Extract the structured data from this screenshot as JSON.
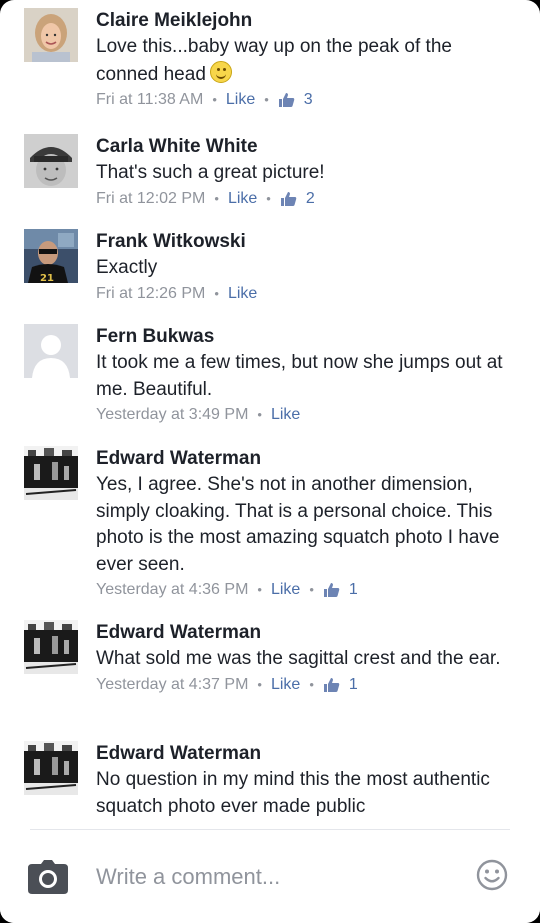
{
  "comments": [
    {
      "author": "Claire Meiklejohn",
      "text": "Love this...baby way up on the peak of the conned head",
      "emoji": "smiley-emoji",
      "time": "Fri at 11:38 AM",
      "like_label": "Like",
      "likes": "3"
    },
    {
      "author": "Carla White White",
      "text": "That's such a great picture!",
      "time": "Fri at 12:02 PM",
      "like_label": "Like",
      "likes": "2"
    },
    {
      "author": "Frank Witkowski",
      "text": "Exactly",
      "time": "Fri at 12:26 PM",
      "like_label": "Like"
    },
    {
      "author": "Fern Bukwas",
      "text": "It took me a few times, but now she jumps out at me. Beautiful.",
      "time": "Yesterday at 3:49 PM",
      "like_label": "Like"
    },
    {
      "author": "Edward Waterman",
      "text": "Yes, I agree. She's not in another dimension, simply cloaking. That is a personal choice. This photo is the most amazing squatch photo I have ever seen.",
      "time": "Yesterday at 4:36 PM",
      "like_label": "Like",
      "likes": "1"
    },
    {
      "author": "Edward Waterman",
      "text": "What sold me was the sagittal crest and the ear.",
      "time": "Yesterday at 4:37 PM",
      "like_label": "Like",
      "likes": "1"
    },
    {
      "author": "Edward Waterman",
      "text": "No question in my mind this the most authentic squatch photo ever made public"
    }
  ],
  "composer": {
    "placeholder": "Write a comment...",
    "camera_icon": "camera-icon",
    "emoji_icon": "smiley-icon"
  },
  "colors": {
    "text": "#1d2129",
    "meta": "#90949c",
    "link": "#4b6ea8",
    "background": "#ffffff"
  }
}
